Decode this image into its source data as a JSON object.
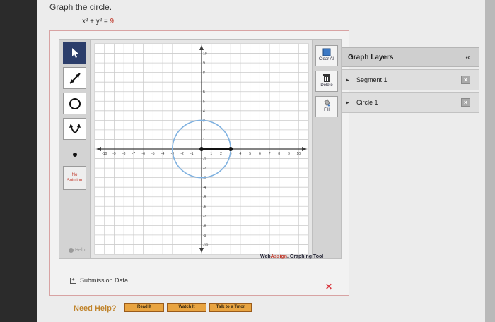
{
  "question": {
    "title": "Graph the circle.",
    "equation_lhs": "x² + y² =",
    "equation_rhs": "9"
  },
  "toolbar": {
    "tools": [
      {
        "name": "pointer",
        "icon": "arrow-pointer-icon"
      },
      {
        "name": "segment",
        "icon": "segment-icon"
      },
      {
        "name": "circle",
        "icon": "circle-icon"
      },
      {
        "name": "parabola",
        "icon": "parabola-icon"
      },
      {
        "name": "point",
        "icon": "point-icon"
      }
    ],
    "no_solution_line1": "No",
    "no_solution_line2": "Solution",
    "help_label": "Help"
  },
  "graph": {
    "x_range": [
      -11,
      11
    ],
    "y_range": [
      -11,
      11
    ],
    "x_ticks": [
      "-10",
      "-9",
      "-8",
      "-7",
      "-6",
      "-5",
      "-4",
      "-3",
      "-2",
      "-1",
      "1",
      "2",
      "3",
      "4",
      "5",
      "6",
      "7",
      "8",
      "9",
      "10"
    ],
    "y_ticks": [
      "10",
      "9",
      "8",
      "7",
      "6",
      "5",
      "4",
      "3",
      "2",
      "1",
      "-1",
      "-2",
      "-3",
      "-4",
      "-5",
      "-6",
      "-7",
      "-8",
      "-9",
      "-10"
    ],
    "circle": {
      "cx": 0,
      "cy": 0,
      "r": 3
    },
    "segment": {
      "x1": 0,
      "y1": 0,
      "x2": 3,
      "y2": 0
    },
    "colors": {
      "circle": "#7fb1e0",
      "segment": "#111111",
      "grid": "#cccccc",
      "axis": "#3a3a3a"
    }
  },
  "actions": {
    "clear_all": "Clear All",
    "delete": "Delete",
    "fill": "Fill"
  },
  "layers": {
    "title": "Graph Layers",
    "collapse_icon": "«",
    "items": [
      {
        "label": "Segment 1"
      },
      {
        "label": "Circle 1"
      }
    ]
  },
  "branding": {
    "web": "Web",
    "assign": "Assign",
    "tool": ". Graphing Tool"
  },
  "submission": {
    "label": "Submission Data",
    "expand_symbol": "+"
  },
  "help": {
    "need_help": "Need Help?",
    "read_it": "Read It",
    "watch_it": "Watch It",
    "talk_to_tutor": "Talk to a Tutor"
  }
}
